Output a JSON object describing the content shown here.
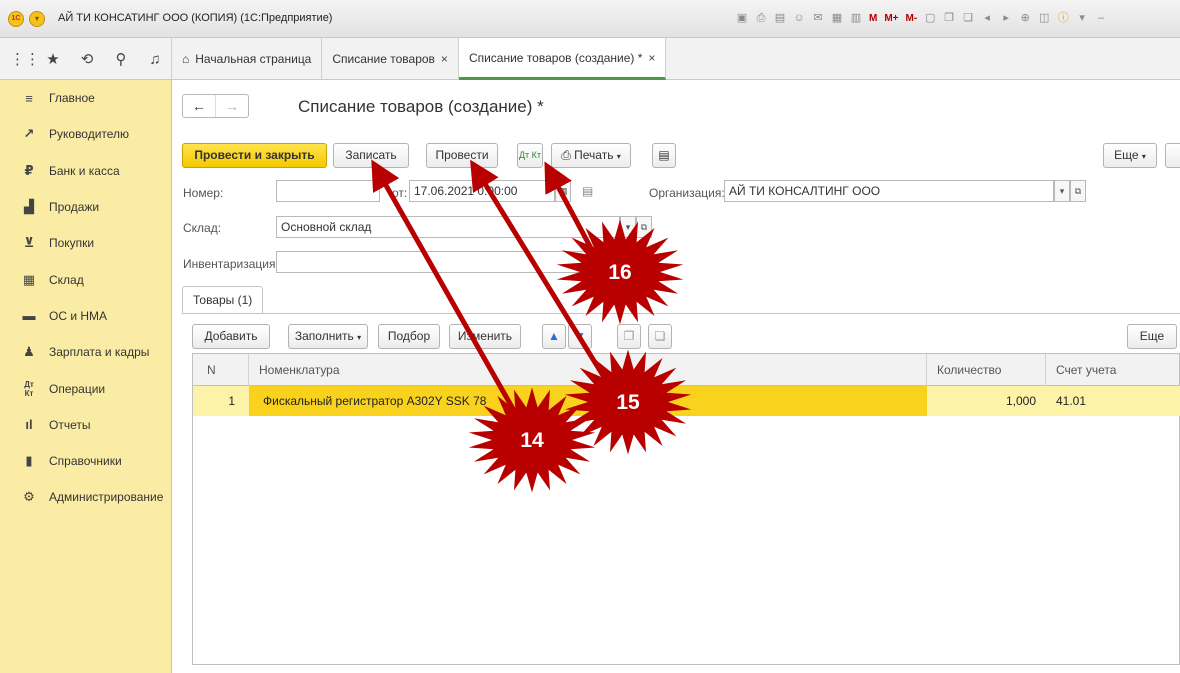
{
  "window": {
    "title": "АЙ ТИ КОНСАТИНГ ООО (КОПИЯ)  (1С:Предприятие)",
    "logo": "1С",
    "toolbar_m": [
      "M",
      "M+",
      "M-"
    ]
  },
  "tabs": [
    {
      "label": "Начальная страница",
      "icon": "home-icon"
    },
    {
      "label": "Списание товаров",
      "close": "×"
    },
    {
      "label": "Списание товаров (создание) *",
      "close": "×"
    }
  ],
  "sidebar": {
    "items": [
      {
        "label": "Главное",
        "icon": "menu-icon"
      },
      {
        "label": "Руководителю",
        "icon": "trend-icon"
      },
      {
        "label": "Банк и касса",
        "icon": "ruble-icon"
      },
      {
        "label": "Продажи",
        "icon": "bag-icon"
      },
      {
        "label": "Покупки",
        "icon": "cart-icon"
      },
      {
        "label": "Склад",
        "icon": "warehouse-icon"
      },
      {
        "label": "ОС и НМА",
        "icon": "truck-icon"
      },
      {
        "label": "Зарплата и кадры",
        "icon": "person-icon"
      },
      {
        "label": "Операции",
        "icon": "dt-kt-icon"
      },
      {
        "label": "Отчеты",
        "icon": "chart-icon"
      },
      {
        "label": "Справочники",
        "icon": "book-icon"
      },
      {
        "label": "Администрирование",
        "icon": "gear-icon"
      }
    ]
  },
  "form": {
    "title": "Списание товаров (создание) *",
    "buttons": {
      "post_close": "Провести и закрыть",
      "save": "Записать",
      "post": "Провести",
      "dtkt": "Дт Кт",
      "print": "Печать",
      "more": "Еще"
    },
    "number_label": "Номер:",
    "number_value": "",
    "date_label": "от:",
    "date_value": "17.06.2021  0:00:00",
    "org_label": "Организация:",
    "org_value": "АЙ ТИ КОНСАЛТИНГ ООО",
    "warehouse_label": "Склад:",
    "warehouse_value": "Основной склад",
    "inventory_label": "Инвентаризация:",
    "inventory_value": ""
  },
  "goods_tab": {
    "label": "Товары (1)",
    "buttons": {
      "add": "Добавить",
      "fill": "Заполнить",
      "pick": "Подбор",
      "change": "Изменить",
      "more": "Еще"
    },
    "columns": [
      "N",
      "Номенклатура",
      "Количество",
      "Счет учета"
    ],
    "rows": [
      {
        "n": "1",
        "item": "Фискальный регистратор А302Y SSK 78",
        "qty": "1,000",
        "account": "41.01"
      }
    ]
  },
  "annotations": [
    {
      "label": "14"
    },
    {
      "label": "15"
    },
    {
      "label": "16"
    }
  ],
  "colors": {
    "sidebar_bg": "#fbeca5",
    "primary_button": "#f5c800",
    "selected_row": "#f9d21e",
    "annotation_burst": "#b80000",
    "annotation_arrow": "#b80000"
  }
}
